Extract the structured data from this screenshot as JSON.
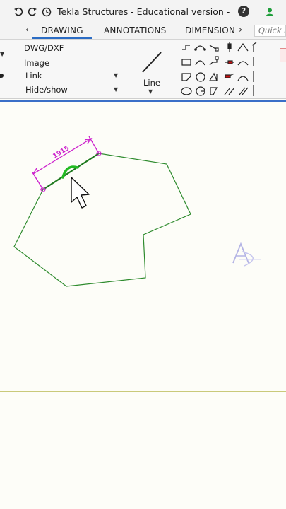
{
  "titlebar": {
    "title": "Tekla Structures - Educational version - C:\\..."
  },
  "tabs": [
    {
      "label": "DRAWING",
      "active": true
    },
    {
      "label": "ANNOTATIONS",
      "active": false
    },
    {
      "label": "DIMENSIONI",
      "active": false
    }
  ],
  "search": {
    "placeholder": "Quick L"
  },
  "ribbon": {
    "insert_items": [
      "DWG/DXF",
      "Image",
      "Link",
      "Hide/show"
    ],
    "line_label": "Line"
  },
  "drawing": {
    "dimension_text": "1915",
    "shape_color": "#2e8b2e",
    "dimension_color": "#cc1fcc"
  },
  "colors": {
    "accent": "#2b6cc4",
    "titlebar_bg": "#f3f3f3",
    "canvas_bg": "#fdfdf8"
  }
}
